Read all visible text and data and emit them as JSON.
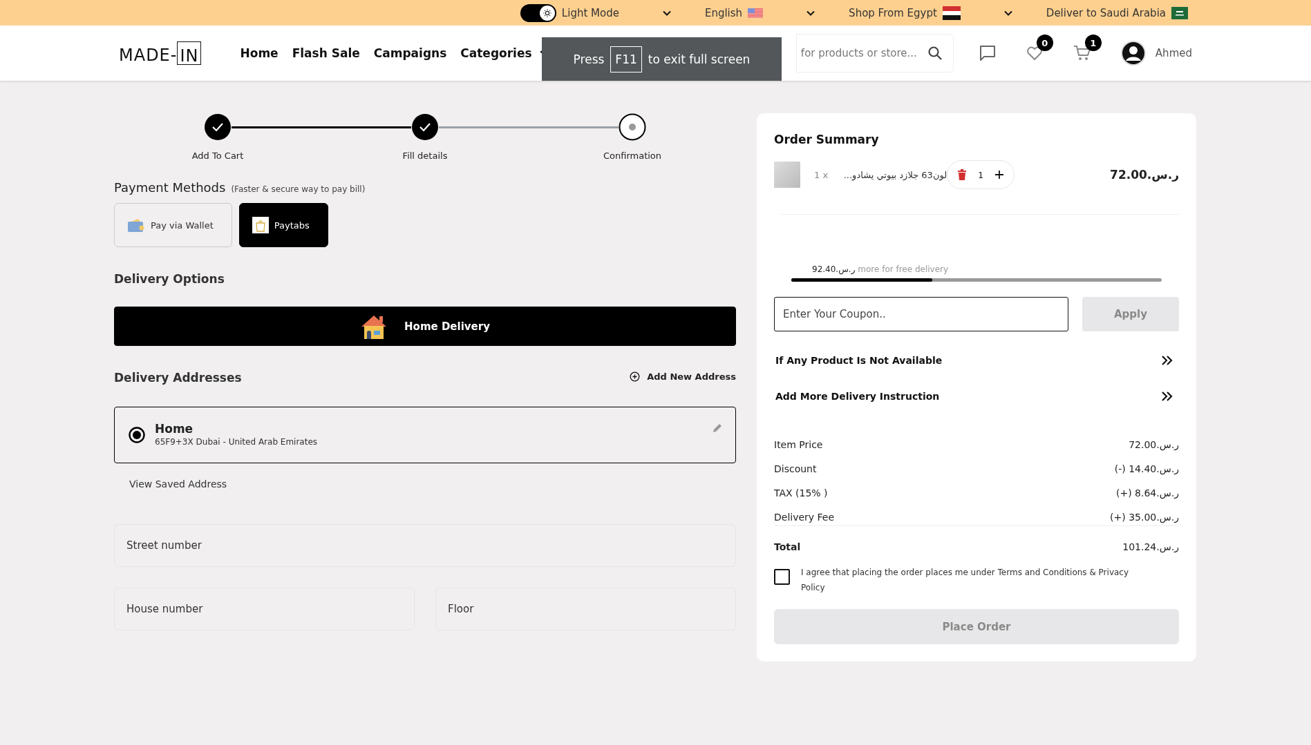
{
  "top_bar": {
    "theme_toggle": {
      "label": "Light Mode",
      "on": true
    },
    "language": "English",
    "shop_from": "Shop From Egypt",
    "deliver_to": "Deliver to Saudi Arabia"
  },
  "header": {
    "logo": {
      "text": "MADE-",
      "bag_text": "IN"
    },
    "nav": [
      {
        "label": "Home",
        "has_dropdown": false
      },
      {
        "label": "Flash Sale",
        "has_dropdown": false
      },
      {
        "label": "Campaigns",
        "has_dropdown": false
      },
      {
        "label": "Categories",
        "has_dropdown": true
      }
    ],
    "search": {
      "placeholder": "for products or store..."
    },
    "wishlist_count": "0",
    "cart_count": "1",
    "user_name": "Ahmed"
  },
  "fullscreen_notice": {
    "text_before": "Press",
    "key": "F11",
    "text_after": "to exit full screen"
  },
  "steps": [
    {
      "label": "Add To Cart",
      "completed": true
    },
    {
      "label": "Fill details",
      "completed": true
    },
    {
      "label": "Confirmation",
      "completed": false
    }
  ],
  "payment": {
    "title": "Payment Methods",
    "subtitle": "(Faster & secure way to pay bill)",
    "methods": [
      {
        "label": "Pay via Wallet",
        "kind": "wallet",
        "selected": false
      },
      {
        "label": "Paytabs",
        "kind": "paytabs",
        "selected": true
      }
    ]
  },
  "delivery_options": {
    "title": "Delivery Options",
    "options": [
      {
        "label": "Home Delivery",
        "selected": true
      }
    ]
  },
  "addresses": {
    "title": "Delivery Addresses",
    "add_link": "Add New Address",
    "items": [
      {
        "name": "Home",
        "detail": "65F9+3X Dubai - United Arab Emirates",
        "selected": true
      }
    ],
    "view_saved": "View Saved Address"
  },
  "address_fields": [
    {
      "placeholder": "Street number",
      "kind": "full"
    },
    {
      "placeholder": "House number",
      "kind": "half"
    },
    {
      "placeholder": "Floor",
      "kind": "half"
    }
  ],
  "summary": {
    "title": "Order Summary",
    "items": [
      {
        "qty_label": "1 x",
        "name": "لون63 جلازد بيوتي يشادو...",
        "quantity": "1",
        "price": "72.00.ر.س"
      }
    ],
    "free_delivery": {
      "amount": "92.40.ر.س",
      "text": "more for free delivery",
      "level": 0.38
    },
    "coupon": {
      "placeholder": "Enter Your Coupon..",
      "apply": "Apply",
      "apply_disabled": true
    },
    "options": [
      "If Any Product Is Not Available",
      "Add More Delivery Instruction"
    ],
    "lines": [
      {
        "label": "Item Price",
        "value": "72.00.ر.س"
      },
      {
        "label": "Discount",
        "value": "(-) 14.40.ر.س"
      },
      {
        "label": "TAX (15% )",
        "value": "(+) 8.64.ر.س"
      },
      {
        "label": "Delivery Fee",
        "value": "(+) 35.00.ر.س"
      }
    ],
    "total": {
      "label": "Total",
      "value": "101.24.ر.س"
    },
    "agreement": {
      "text": "I agree that placing the order places me under Terms and Conditions & Privacy Policy",
      "checked": false
    },
    "place_order": {
      "label": "Place Order",
      "disabled": true
    }
  }
}
